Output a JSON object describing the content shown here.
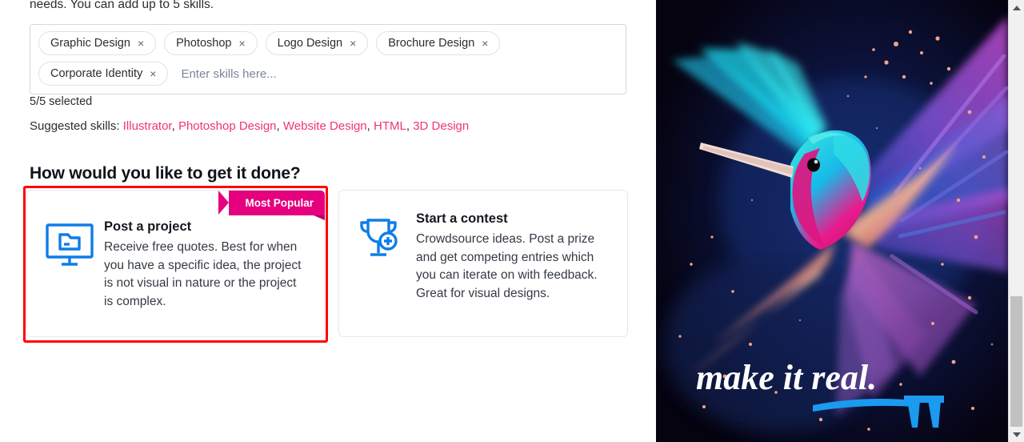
{
  "page": {
    "intro_text": "needs. You can add up to 5 skills.",
    "count_text": "5/5 selected",
    "section_heading": "How would you like to get it done?"
  },
  "skills_field": {
    "placeholder": "Enter skills here...",
    "value": "",
    "remove_glyph": "×",
    "chips": [
      {
        "label": "Graphic Design"
      },
      {
        "label": "Photoshop"
      },
      {
        "label": "Logo Design"
      },
      {
        "label": "Brochure Design"
      },
      {
        "label": "Corporate Identity"
      }
    ]
  },
  "suggested": {
    "label": "Suggested skills:",
    "separator": ",",
    "items": [
      {
        "label": "Illustrator"
      },
      {
        "label": "Photoshop Design"
      },
      {
        "label": "Website Design"
      },
      {
        "label": "HTML"
      },
      {
        "label": "3D Design"
      }
    ],
    "link_color": "#f0356f"
  },
  "options": {
    "project": {
      "icon": "monitor-folder-icon",
      "title": "Post a project",
      "description": "Receive free quotes. Best for when you have a specific idea, the project is not visual in nature or the project is complex.",
      "badge": "Most Popular",
      "badge_color": "#e5007d",
      "selected": true,
      "highlight_color": "#ff0000"
    },
    "contest": {
      "icon": "trophy-plus-icon",
      "title": "Start a contest",
      "description": "Crowdsource ideas. Post a prize and get competing entries which you can iterate on with feedback. Great for visual designs.",
      "selected": false
    }
  },
  "promo": {
    "tagline": "make it real.",
    "artwork": "hummingbird-color-powder-artwork",
    "accent_color": "#1a9bf0"
  },
  "scrollbar": {
    "up_arrow": "scroll-up-arrow-icon",
    "down_arrow": "scroll-down-arrow-icon",
    "thumb_position_percent": 70
  },
  "icon_color": "#0e7de8"
}
